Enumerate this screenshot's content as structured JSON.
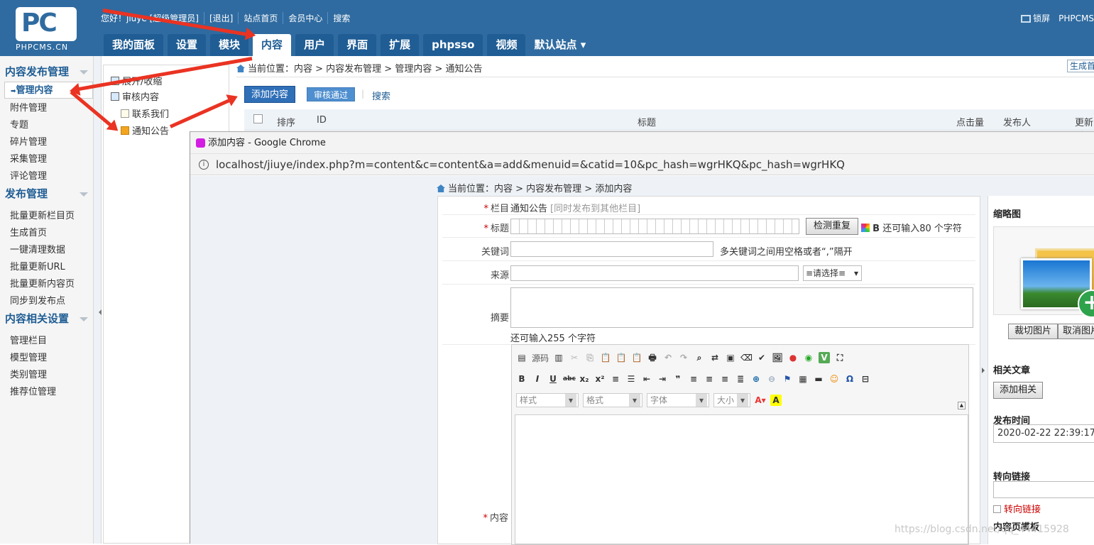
{
  "header": {
    "logo_text": "PC",
    "logo_sub": "PHPCMS.CN",
    "links": [
      "您好！jiuye [超级管理员]",
      "[退出]",
      "站点首页",
      "会员中心",
      "搜索"
    ],
    "lock": "锁屏",
    "brand": "PHPCMS",
    "tabs": [
      "我的面板",
      "设置",
      "模块",
      "内容",
      "用户",
      "界面",
      "扩展",
      "phpsso",
      "视频"
    ],
    "active_tab": "内容",
    "site": "默认站点"
  },
  "sidebar": {
    "groups": [
      {
        "title": "内容发布管理",
        "items": [
          "管理内容",
          "附件管理",
          "专题",
          "碎片管理",
          "采集管理",
          "评论管理"
        ]
      },
      {
        "title": "发布管理",
        "items": [
          "批量更新栏目页",
          "生成首页",
          "一键清理数据",
          "批量更新URL",
          "批量更新内容页",
          "同步到发布点"
        ]
      },
      {
        "title": "内容相关设置",
        "items": [
          "管理栏目",
          "模型管理",
          "类别管理",
          "推荐位管理"
        ]
      }
    ],
    "active_item": "管理内容"
  },
  "tree": {
    "items": [
      "展开/收缩",
      "审核内容",
      "联系我们",
      "通知公告"
    ]
  },
  "main": {
    "breadcrumb": "当前位置：内容 > 内容发布管理 > 管理内容 > 通知公告",
    "gen_button": "生成首页",
    "add_button": "添加内容",
    "approved_button": "审核通过",
    "search_link": "搜索",
    "table_headers": [
      "排序",
      "ID",
      "标题",
      "点击量",
      "发布人",
      "更新时"
    ]
  },
  "popup": {
    "window_title": "添加内容 - Google Chrome",
    "url": "localhost/jiuye/index.php?m=content&c=content&a=add&menuid=&catid=10&pc_hash=wgrHKQ&pc_hash=wgrHKQ",
    "breadcrumb": "当前位置：内容 > 内容发布管理 > 添加内容",
    "form": {
      "category_label": "栏目",
      "category_value": "通知公告",
      "category_hint": "[同时发布到其他栏目]",
      "title_label": "标题",
      "check_button": "检测重复",
      "title_bold": "B",
      "title_remain": "还可输入80 个字符",
      "keywords_label": "关键词",
      "keywords_hint": "多关键词之间用空格或者“,”隔开",
      "source_label": "来源",
      "source_select": "≡请选择≡",
      "summary_label": "摘要",
      "summary_remain": "还可输入255 个字符",
      "content_label": "内容",
      "editor": {
        "source_btn": "源码",
        "style_combo": "样式",
        "format_combo": "格式",
        "font_combo": "字体",
        "size_combo": "大小"
      }
    },
    "right_panel": {
      "thumb_label": "缩略图",
      "crop_button": "裁切图片",
      "cancel_button": "取消图片",
      "related_label": "相关文章",
      "add_related_button": "添加相关",
      "pubtime_label": "发布时间",
      "pubtime_value": "2020-02-22 22:39:17",
      "redirect_label": "转向链接",
      "redirect_check": "转向链接",
      "template_label": "内容页模板"
    }
  },
  "watermark": "https://blog.csdn.net/qq_44415928",
  "colors": {
    "accent": "#2f6ba0",
    "arrow": "#ea3323"
  }
}
